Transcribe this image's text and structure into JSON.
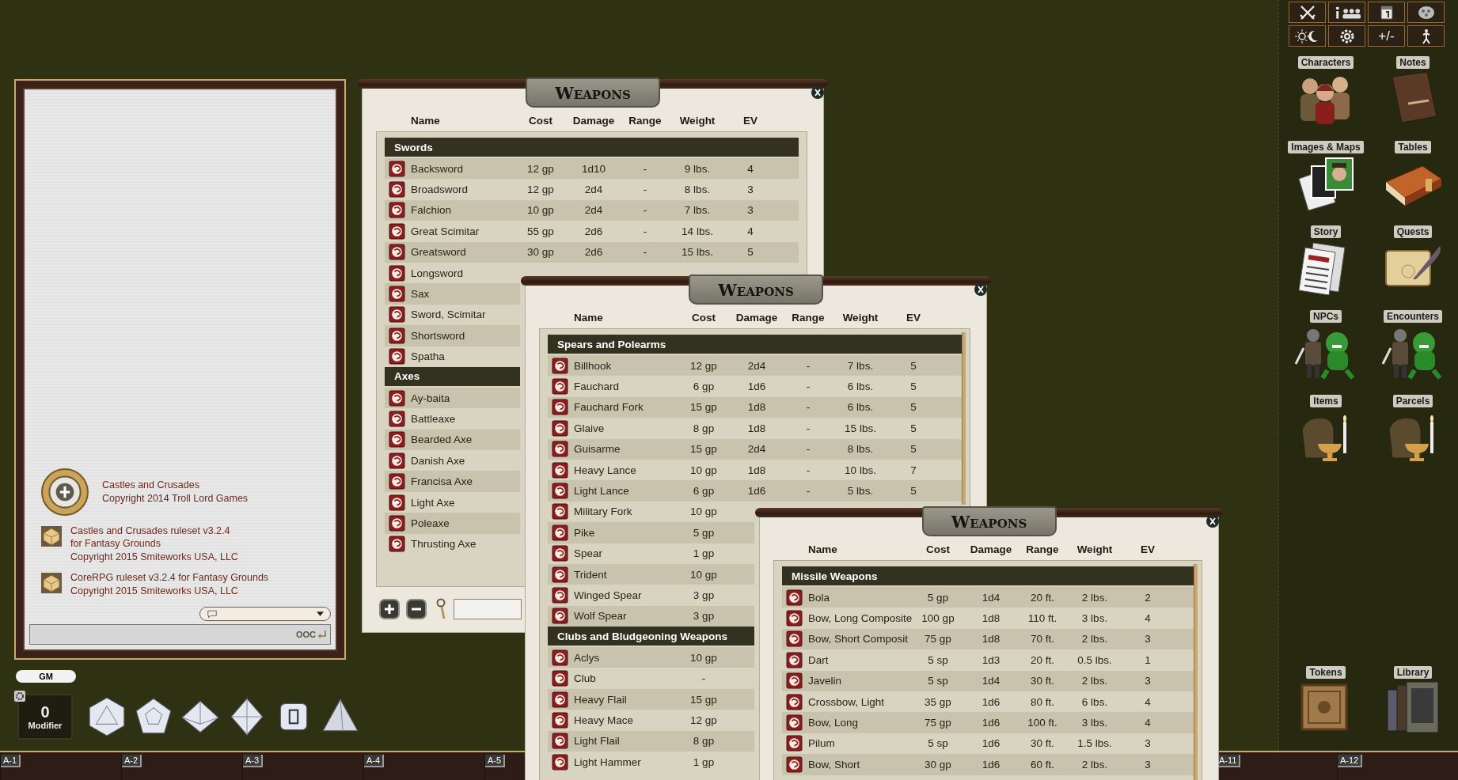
{
  "windows": [
    {
      "title": "Weapons",
      "kind": "footer",
      "columns": [
        "Name",
        "Cost",
        "Damage",
        "Range",
        "Weight",
        "EV"
      ],
      "groups": [
        {
          "name": "Swords",
          "rows": [
            {
              "name": "Backsword",
              "values": [
                "12 gp",
                "1d10",
                "-",
                "9 lbs.",
                "4"
              ]
            },
            {
              "name": "Broadsword",
              "values": [
                "12 gp",
                "2d4",
                "-",
                "8 lbs.",
                "3"
              ]
            },
            {
              "name": "Falchion",
              "values": [
                "10 gp",
                "2d4",
                "-",
                "7 lbs.",
                "3"
              ]
            },
            {
              "name": "Great Scimitar",
              "values": [
                "55 gp",
                "2d6",
                "-",
                "14 lbs.",
                "4"
              ]
            },
            {
              "name": "Greatsword",
              "values": [
                "30 gp",
                "2d6",
                "-",
                "15 lbs.",
                "5"
              ]
            },
            {
              "name": "Longsword",
              "values": []
            },
            {
              "name": "Sax",
              "values": []
            },
            {
              "name": "Sword, Scimitar",
              "values": []
            },
            {
              "name": "Shortsword",
              "values": []
            },
            {
              "name": "Spatha",
              "values": []
            }
          ]
        },
        {
          "name": "Axes",
          "rows": [
            {
              "name": "Ay-baita",
              "values": []
            },
            {
              "name": "Battleaxe",
              "values": []
            },
            {
              "name": "Bearded Axe",
              "values": []
            },
            {
              "name": "Danish Axe",
              "values": []
            },
            {
              "name": "Francisa Axe",
              "values": []
            },
            {
              "name": "Light Axe",
              "values": []
            },
            {
              "name": "Poleaxe",
              "values": []
            },
            {
              "name": "Thrusting Axe",
              "values": []
            }
          ]
        }
      ]
    },
    {
      "title": "Weapons",
      "kind": "scroll",
      "columns": [
        "Name",
        "Cost",
        "Damage",
        "Range",
        "Weight",
        "EV"
      ],
      "groups": [
        {
          "name": "Spears and Polearms",
          "rows": [
            {
              "name": "Billhook",
              "values": [
                "12 gp",
                "2d4",
                "-",
                "7 lbs.",
                "5"
              ]
            },
            {
              "name": "Fauchard",
              "values": [
                "6 gp",
                "1d6",
                "-",
                "6 lbs.",
                "5"
              ]
            },
            {
              "name": "Fauchard Fork",
              "values": [
                "15 gp",
                "1d8",
                "-",
                "6 lbs.",
                "5"
              ]
            },
            {
              "name": "Glaive",
              "values": [
                "8 gp",
                "1d8",
                "-",
                "15 lbs.",
                "5"
              ]
            },
            {
              "name": "Guisarme",
              "values": [
                "15 gp",
                "2d4",
                "-",
                "8 lbs.",
                "5"
              ]
            },
            {
              "name": "Heavy Lance",
              "values": [
                "10 gp",
                "1d8",
                "-",
                "10 lbs.",
                "7"
              ]
            },
            {
              "name": "Light Lance",
              "values": [
                "6 gp",
                "1d6",
                "-",
                "5 lbs.",
                "5"
              ]
            },
            {
              "name": "Military Fork",
              "values": [
                "10 gp"
              ]
            },
            {
              "name": "Pike",
              "values": [
                "5 gp"
              ]
            },
            {
              "name": "Spear",
              "values": [
                "1 gp"
              ]
            },
            {
              "name": "Trident",
              "values": [
                "10 gp"
              ]
            },
            {
              "name": "Winged Spear",
              "values": [
                "3 gp"
              ]
            },
            {
              "name": "Wolf Spear",
              "values": [
                "3 gp"
              ]
            }
          ]
        },
        {
          "name": "Clubs and Bludgeoning Weapons",
          "rows": [
            {
              "name": "Aclys",
              "values": [
                "10 gp"
              ]
            },
            {
              "name": "Club",
              "values": [
                "-"
              ]
            },
            {
              "name": "Heavy Flail",
              "values": [
                "15 gp"
              ]
            },
            {
              "name": "Heavy Mace",
              "values": [
                "12 gp"
              ]
            },
            {
              "name": "Light Flail",
              "values": [
                "8 gp"
              ]
            },
            {
              "name": "Light Hammer",
              "values": [
                "1 gp"
              ]
            }
          ]
        }
      ]
    },
    {
      "title": "Weapons",
      "kind": "scroll",
      "columns": [
        "Name",
        "Cost",
        "Damage",
        "Range",
        "Weight",
        "EV"
      ],
      "groups": [
        {
          "name": "Missile Weapons",
          "rows": [
            {
              "name": "Bola",
              "values": [
                "5 gp",
                "1d4",
                "20 ft.",
                "2 lbs.",
                "2"
              ]
            },
            {
              "name": "Bow, Long Composite",
              "values": [
                "100 gp",
                "1d8",
                "110 ft.",
                "3 lbs.",
                "4"
              ]
            },
            {
              "name": "Bow, Short Composit",
              "values": [
                "75 gp",
                "1d8",
                "70 ft.",
                "2 lbs.",
                "3"
              ]
            },
            {
              "name": "Dart",
              "values": [
                "5 sp",
                "1d3",
                "20 ft.",
                "0.5 lbs.",
                "1"
              ]
            },
            {
              "name": "Javelin",
              "values": [
                "5 sp",
                "1d4",
                "30 ft.",
                "2 lbs.",
                "3"
              ]
            },
            {
              "name": "Crossbow, Light",
              "values": [
                "35 gp",
                "1d6",
                "80 ft.",
                "6 lbs.",
                "4"
              ]
            },
            {
              "name": "Bow, Long",
              "values": [
                "75 gp",
                "1d6",
                "100 ft.",
                "3 lbs.",
                "4"
              ]
            },
            {
              "name": "Pilum",
              "values": [
                "5 sp",
                "1d6",
                "30 ft.",
                "1.5 lbs.",
                "3"
              ]
            },
            {
              "name": "Bow, Short",
              "values": [
                "30 gp",
                "1d6",
                "60 ft.",
                "2 lbs.",
                "3"
              ]
            }
          ]
        }
      ]
    }
  ],
  "chat": {
    "messages": [
      {
        "kind": "logo",
        "text": "Castles and Crusades\nCopyright 2014 Troll Lord Games"
      },
      {
        "kind": "ruleset",
        "text": "Castles and Crusades ruleset v3.2.4\nfor Fantasy Grounds\nCopyright 2015 Smiteworks USA, LLC"
      },
      {
        "kind": "ruleset",
        "text": "CoreRPG ruleset v3.2.4 for Fantasy Grounds\nCopyright 2015 Smiteworks USA, LLC"
      }
    ],
    "ooc": "OOC"
  },
  "identity": "GM",
  "modifier": {
    "value": "0",
    "label": "Modifier"
  },
  "dice": [
    {
      "kind": "d20"
    },
    {
      "kind": "d12"
    },
    {
      "kind": "d10"
    },
    {
      "kind": "d8"
    },
    {
      "kind": "d6"
    },
    {
      "kind": "d4"
    }
  ],
  "toolbar": [
    {
      "kind": "combat"
    },
    {
      "kind": "party"
    },
    {
      "kind": "calendar"
    },
    {
      "kind": "dice"
    },
    {
      "kind": "lighting"
    },
    {
      "kind": "options"
    },
    {
      "kind": "text",
      "label": "+/-"
    },
    {
      "kind": "character"
    }
  ],
  "sidebar": {
    "items": [
      {
        "label": "Characters",
        "kind": "characters"
      },
      {
        "label": "Notes",
        "kind": "notes"
      },
      {
        "label": "Images & Maps",
        "kind": "images"
      },
      {
        "label": "Tables",
        "kind": "tables"
      },
      {
        "label": "Story",
        "kind": "story"
      },
      {
        "label": "Quests",
        "kind": "quests"
      },
      {
        "label": "NPCs",
        "kind": "npcs"
      },
      {
        "label": "Encounters",
        "kind": "npcs"
      },
      {
        "label": "Items",
        "kind": "items"
      },
      {
        "label": "Parcels",
        "kind": "items"
      }
    ],
    "bottom": [
      {
        "label": "Tokens",
        "kind": "tokens"
      },
      {
        "label": "Library",
        "kind": "library"
      }
    ]
  },
  "hotkeys": {
    "left": [
      "A-1",
      "A-2",
      "A-3",
      "A-4",
      "A-5"
    ],
    "right": [
      "A-11",
      "A-12"
    ]
  }
}
